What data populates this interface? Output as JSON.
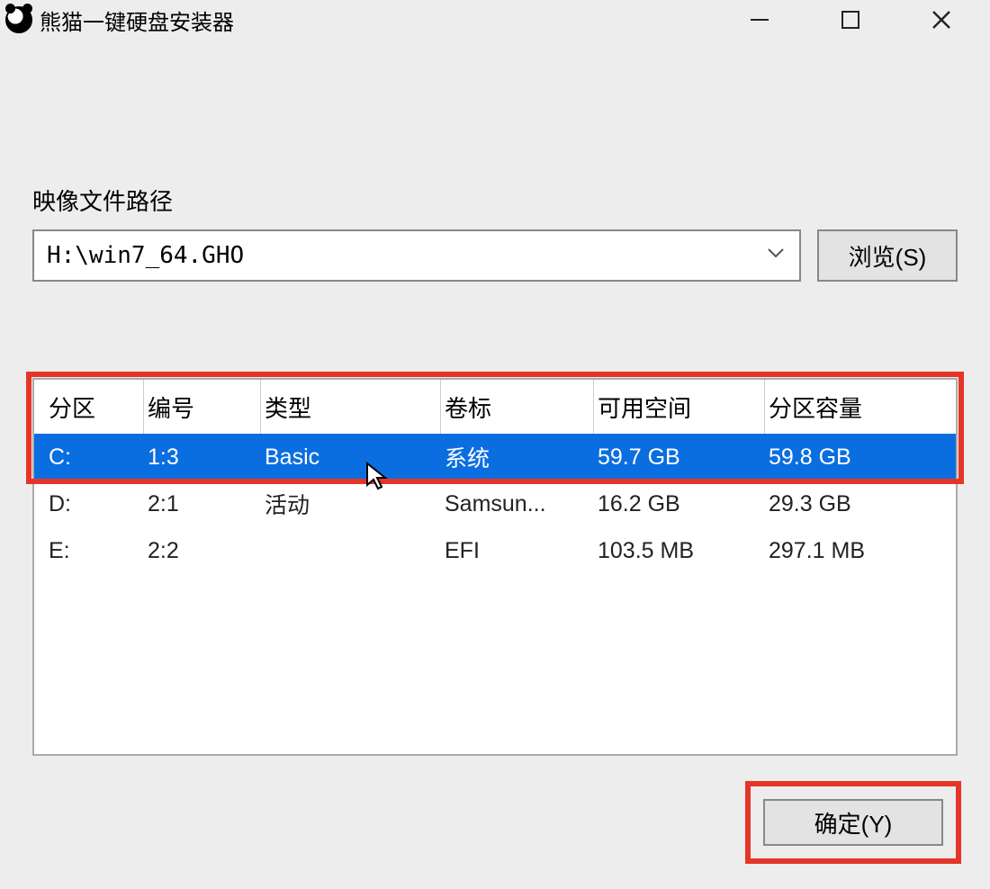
{
  "titlebar": {
    "title": "熊猫一键硬盘安装器"
  },
  "path": {
    "label": "映像文件路径",
    "value": "H:\\win7_64.GHO",
    "browse_label": "浏览(S)"
  },
  "table": {
    "headers": {
      "partition": "分区",
      "number": "编号",
      "type": "类型",
      "volume": "卷标",
      "free": "可用空间",
      "capacity": "分区容量"
    },
    "rows": [
      {
        "partition": "C:",
        "number": "1:3",
        "type": "Basic",
        "volume": "系统",
        "free": "59.7 GB",
        "capacity": "59.8 GB",
        "selected": true
      },
      {
        "partition": "D:",
        "number": "2:1",
        "type": "活动",
        "volume": "Samsun...",
        "free": "16.2 GB",
        "capacity": "29.3 GB",
        "selected": false
      },
      {
        "partition": "E:",
        "number": "2:2",
        "type": "",
        "volume": "EFI",
        "free": "103.5 MB",
        "capacity": "297.1 MB",
        "selected": false
      }
    ]
  },
  "buttons": {
    "ok": "确定(Y)"
  },
  "highlight_color": "#e53528",
  "selection_color": "#0a6ee0"
}
